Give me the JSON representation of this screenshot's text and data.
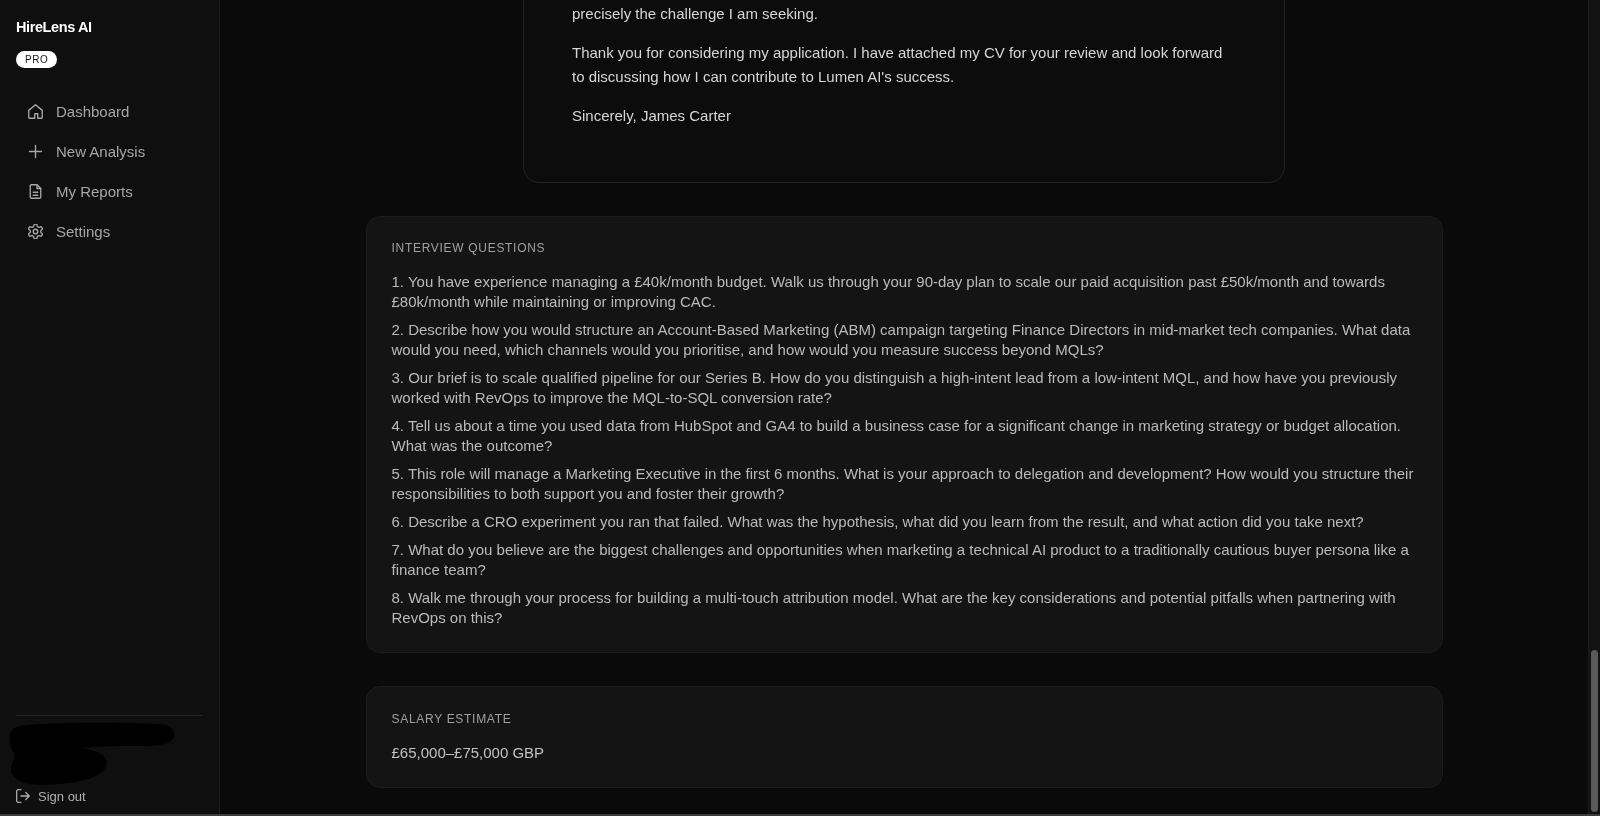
{
  "sidebar": {
    "brand": "HireLens AI",
    "plan_badge": "PRO",
    "nav": [
      {
        "label": "Dashboard",
        "selected": false
      },
      {
        "label": "New Analysis",
        "selected": false
      },
      {
        "label": "My Reports",
        "selected": false
      },
      {
        "label": "Settings",
        "selected": false
      }
    ],
    "sign_out": "Sign out"
  },
  "cover_letter": {
    "paragraphs": [
      "precisely the challenge I am seeking.",
      "Thank you for considering my application. I have attached my CV for your review and look forward to discussing how I can contribute to Lumen AI's success.",
      "Sincerely, James Carter"
    ]
  },
  "interview_questions": {
    "heading": "INTERVIEW QUESTIONS",
    "questions": [
      "1. You have experience managing a £40k/month budget. Walk us through your 90-day plan to scale our paid acquisition past £50k/month and towards £80k/month while maintaining or improving CAC.",
      "2. Describe how you would structure an Account-Based Marketing (ABM) campaign targeting Finance Directors in mid-market tech companies. What data would you need, which channels would you prioritise, and how would you measure success beyond MQLs?",
      "3. Our brief is to scale qualified pipeline for our Series B. How do you distinguish a high-intent lead from a low-intent MQL, and how have you previously worked with RevOps to improve the MQL-to-SQL conversion rate?",
      "4. Tell us about a time you used data from HubSpot and GA4 to build a business case for a significant change in marketing strategy or budget allocation. What was the outcome?",
      "5. This role will manage a Marketing Executive in the first 6 months. What is your approach to delegation and development? How would you structure their responsibilities to both support you and foster their growth?",
      "6. Describe a CRO experiment you ran that failed. What was the hypothesis, what did you learn from the result, and what action did you take next?",
      "7. What do you believe are the biggest challenges and opportunities when marketing a technical AI product to a traditionally cautious buyer persona like a finance team?",
      "8. Walk me through your process for building a multi-touch attribution model. What are the key considerations and potential pitfalls when partnering with RevOps on this?"
    ]
  },
  "salary_estimate": {
    "heading": "SALARY ESTIMATE",
    "value": "£65,000–£75,000 GBP"
  }
}
